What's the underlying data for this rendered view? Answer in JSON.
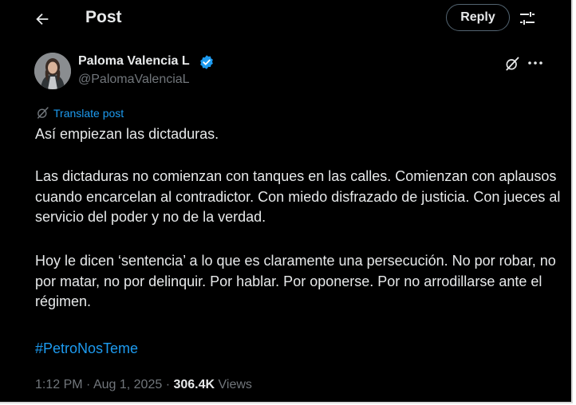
{
  "header": {
    "title": "Post",
    "reply_label": "Reply"
  },
  "author": {
    "display_name": "Paloma Valencia L",
    "handle": "@PalomaValenciaL",
    "verified": true
  },
  "translate_label": "Translate post",
  "post": {
    "paragraphs": [
      "Así empiezan las dictaduras.",
      "Las dictaduras no comienzan con tanques en las calles. Comienzan con aplausos cuando encarcelan al contradictor. Con miedo disfrazado de justicia. Con jueces al servicio del poder y no de la verdad.",
      "Hoy le dicen ‘sentencia’ a lo que es claramente una persecución. No por robar, no por matar, no por delinquir. Por hablar. Por oponerse. Por no arrodillarse ante el régimen."
    ],
    "hashtag": "#PetroNosTeme"
  },
  "meta": {
    "time": "1:12 PM",
    "separator": "·",
    "date": "Aug 1, 2025",
    "views_count": "306.4K",
    "views_label": "Views"
  },
  "icons": {
    "back": "arrow-left-icon",
    "filter": "sliders-icon",
    "verified": "verified-badge-icon",
    "grok": "grok-icon",
    "more": "more-horizontal-icon",
    "translate": "grok-icon"
  },
  "colors": {
    "background": "#000000",
    "text": "#e7e9ea",
    "secondary": "#71767b",
    "accent": "#1d9bf0"
  }
}
